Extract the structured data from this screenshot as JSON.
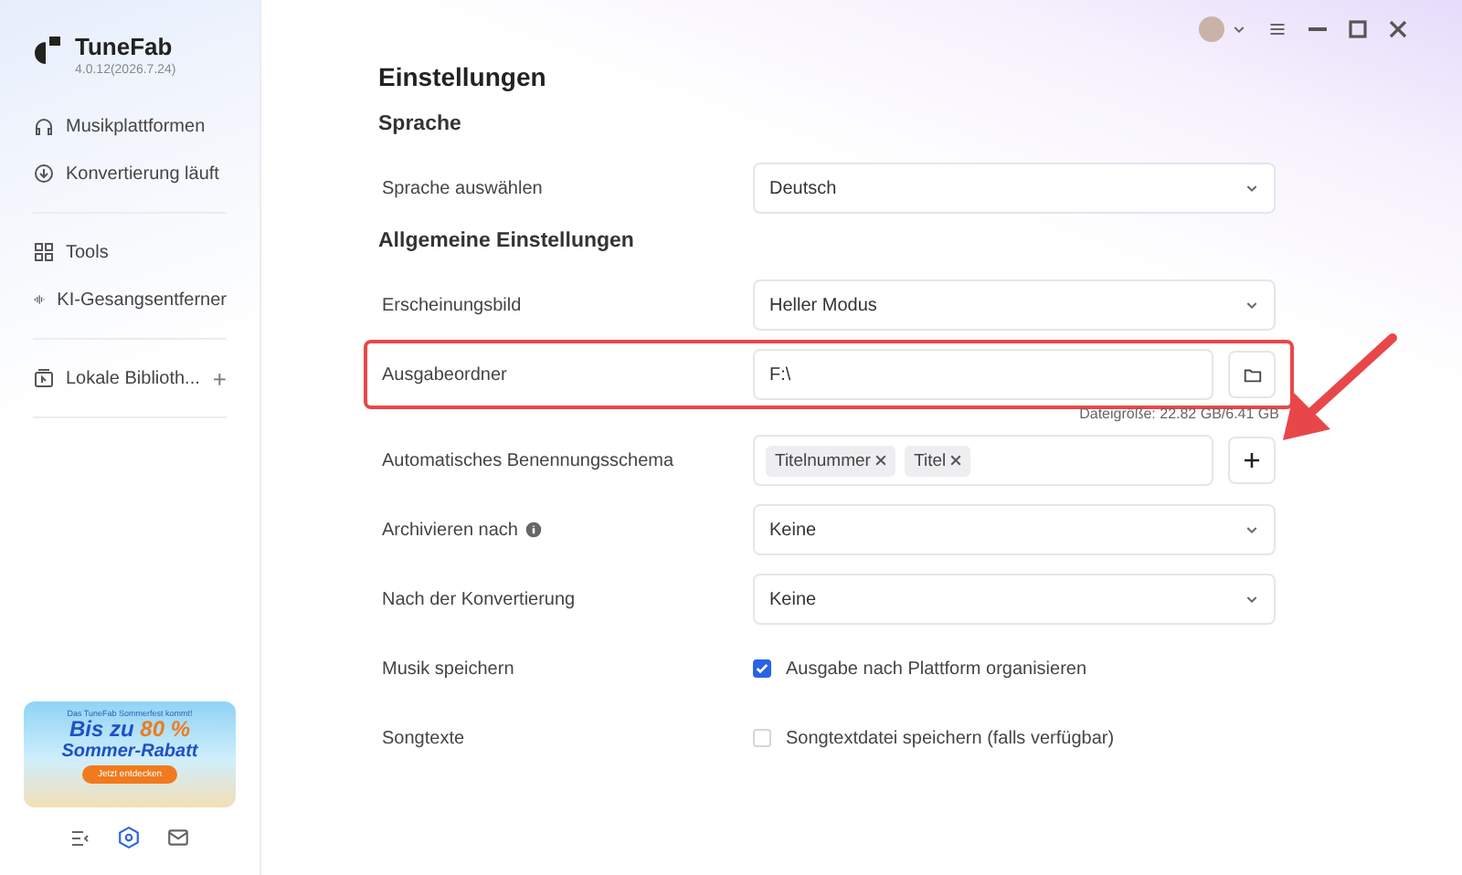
{
  "app": {
    "name": "TuneFab",
    "version": "4.0.12(2026.7.24)"
  },
  "sidebar": {
    "groups": [
      [
        {
          "label": "Musikplattformen",
          "selected": false
        },
        {
          "label": "Konvertierung läuft",
          "selected": false
        }
      ],
      [
        {
          "label": "Tools",
          "selected": false
        },
        {
          "label": "KI-Gesangsentferner",
          "selected": false
        }
      ],
      [
        {
          "label": "Lokale Biblioth...",
          "selected": false,
          "action": "+"
        }
      ]
    ]
  },
  "banner": {
    "tagline": "Das TuneFab Sommerfest kommt!",
    "headline_1": "Bis zu",
    "headline_highlight": "80 %",
    "headline_2": "Sommer-Rabatt",
    "button": "Jetzt entdecken"
  },
  "page": {
    "title": "Einstellungen",
    "sections": [
      {
        "title": "Sprache",
        "rows": [
          {
            "kind": "select",
            "label": "Sprache auswählen",
            "value": "Deutsch"
          }
        ]
      },
      {
        "title": "Allgemeine Einstellungen",
        "rows": [
          {
            "kind": "select",
            "label": "Erscheinungsbild",
            "value": "Heller Modus"
          },
          {
            "kind": "folder",
            "label": "Ausgabeordner",
            "value": "F:\\",
            "note": "Dateigröße: 22.82 GB/6.41 GB",
            "highlighted": true
          },
          {
            "kind": "tags",
            "label": "Automatisches Benennungsschema",
            "tags": [
              "Titelnummer",
              "Titel"
            ]
          },
          {
            "kind": "select",
            "label": "Archivieren nach",
            "value": "Keine",
            "info": true
          },
          {
            "kind": "select",
            "label": "Nach der Konvertierung",
            "value": "Keine"
          },
          {
            "kind": "checkbox",
            "label": "Musik speichern",
            "text": "Ausgabe nach Plattform organisieren",
            "checked": true
          },
          {
            "kind": "checkbox",
            "label": "Songtexte",
            "text": "Songtextdatei speichern (falls verfügbar)",
            "checked": false
          }
        ]
      }
    ]
  }
}
